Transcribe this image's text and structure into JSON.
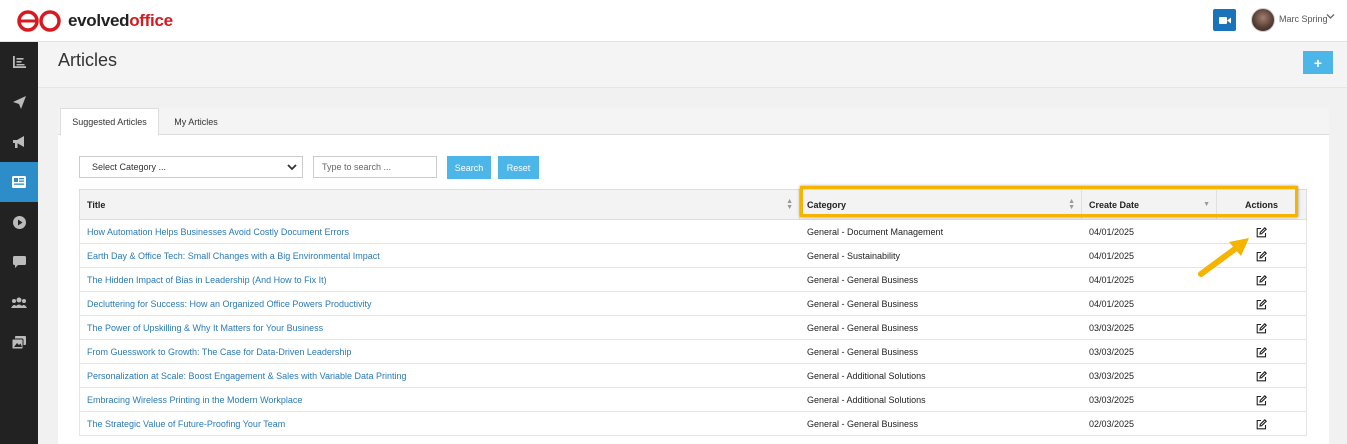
{
  "app": {
    "logo_text_1": "evolved",
    "logo_text_2": "office",
    "user_name": "Marc Spring",
    "brand_red": "#d71920",
    "accent_blue": "#4cb6e8"
  },
  "sidebar": {
    "items": [
      {
        "icon": "reports-icon",
        "active": false
      },
      {
        "icon": "send-icon",
        "active": false
      },
      {
        "icon": "megaphone-icon",
        "active": false
      },
      {
        "icon": "articles-icon",
        "active": true
      },
      {
        "icon": "play-icon",
        "active": false
      },
      {
        "icon": "chat-icon",
        "active": false
      },
      {
        "icon": "users-icon",
        "active": false
      },
      {
        "icon": "gallery-icon",
        "active": false
      }
    ]
  },
  "page": {
    "title": "Articles",
    "add_label": "+"
  },
  "tabs": [
    {
      "label": "Suggested Articles",
      "active": true
    },
    {
      "label": "My Articles",
      "active": false
    }
  ],
  "filters": {
    "category_selected": "Select Category ...",
    "search_placeholder": "Type to search ...",
    "search_label": "Search",
    "reset_label": "Reset"
  },
  "table": {
    "headers": {
      "title": "Title",
      "category": "Category",
      "create_date": "Create Date",
      "actions": "Actions"
    },
    "rows": [
      {
        "title": "How Automation Helps Businesses Avoid Costly Document Errors",
        "category": "General - Document Management",
        "date": "04/01/2025"
      },
      {
        "title": "Earth Day & Office Tech: Small Changes with a Big Environmental Impact",
        "category": "General - Sustainability",
        "date": "04/01/2025"
      },
      {
        "title": "The Hidden Impact of Bias in Leadership (And How to Fix It)",
        "category": "General - General Business",
        "date": "04/01/2025"
      },
      {
        "title": "Decluttering for Success: How an Organized Office Powers Productivity",
        "category": "General - General Business",
        "date": "04/01/2025"
      },
      {
        "title": "The Power of Upskilling & Why It Matters for Your Business",
        "category": "General - General Business",
        "date": "03/03/2025"
      },
      {
        "title": "From Guesswork to Growth: The Case for Data-Driven Leadership",
        "category": "General - General Business",
        "date": "03/03/2025"
      },
      {
        "title": "Personalization at Scale: Boost Engagement & Sales with Variable Data Printing",
        "category": "General - Additional Solutions",
        "date": "03/03/2025"
      },
      {
        "title": "Embracing Wireless Printing in the Modern Workplace",
        "category": "General - Additional Solutions",
        "date": "03/03/2025"
      },
      {
        "title": "The Strategic Value of Future-Proofing Your Team",
        "category": "General - General Business",
        "date": "02/03/2025"
      }
    ]
  }
}
